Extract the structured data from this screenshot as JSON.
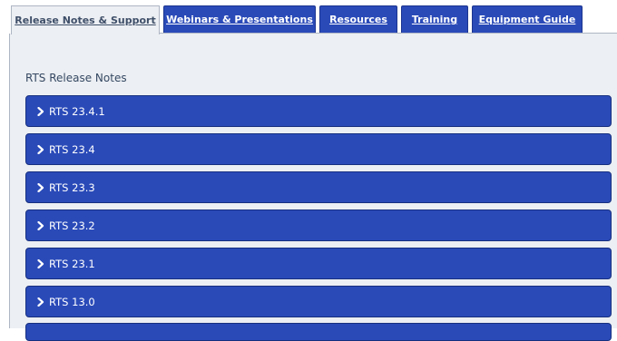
{
  "tabs": [
    {
      "label": "Release Notes & Support",
      "active": true
    },
    {
      "label": "Webinars & Presentations",
      "active": false
    },
    {
      "label": "Resources",
      "active": false
    },
    {
      "label": "Training",
      "active": false
    },
    {
      "label": "Equipment Guide",
      "active": false
    }
  ],
  "section_title": "RTS Release Notes",
  "release_items": [
    {
      "label": "RTS 23.4.1",
      "icon": "chevron-right-icon"
    },
    {
      "label": "RTS 23.4",
      "icon": "chevron-right-icon"
    },
    {
      "label": "RTS 23.3",
      "icon": "chevron-right-icon"
    },
    {
      "label": "RTS 23.2",
      "icon": "chevron-right-icon"
    },
    {
      "label": "RTS 23.1",
      "icon": "chevron-right-icon"
    },
    {
      "label": "RTS 13.0",
      "icon": "chevron-right-icon"
    }
  ],
  "colors": {
    "accent": "#2a4ab8",
    "panel_bg": "#eceff3",
    "active_tab_text": "#3f4f69"
  }
}
